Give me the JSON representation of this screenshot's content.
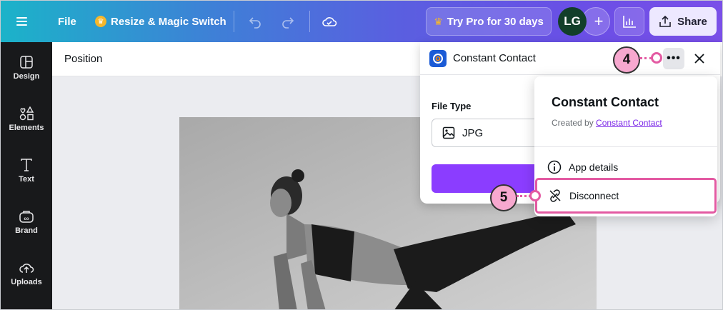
{
  "topbar": {
    "file_label": "File",
    "resize_label": "Resize & Magic Switch",
    "try_pro_label": "Try Pro for 30 days",
    "avatar_initials": "LG",
    "share_label": "Share"
  },
  "sidebar": {
    "items": [
      {
        "label": "Design",
        "icon": "design-icon"
      },
      {
        "label": "Elements",
        "icon": "elements-icon"
      },
      {
        "label": "Text",
        "icon": "text-icon"
      },
      {
        "label": "Brand",
        "icon": "brand-icon"
      },
      {
        "label": "Uploads",
        "icon": "uploads-icon"
      }
    ]
  },
  "position_bar": {
    "label": "Position"
  },
  "app_panel": {
    "title": "Constant Contact",
    "file_type_label": "File Type",
    "file_type_value": "JPG"
  },
  "app_menu": {
    "title": "Constant Contact",
    "created_by_prefix": "Created by",
    "created_by_link": "Constant Contact",
    "items": [
      {
        "label": "App details",
        "icon": "info-icon"
      },
      {
        "label": "Disconnect",
        "icon": "unlink-icon"
      }
    ]
  },
  "callouts": {
    "step4": "4",
    "step5": "5"
  },
  "colors": {
    "accent": "#8b3dff",
    "highlight": "#e35aa2",
    "callout_fill": "#f7a8cf",
    "sidebar_bg": "#18191b"
  }
}
